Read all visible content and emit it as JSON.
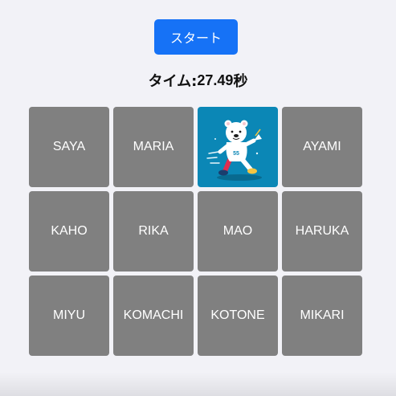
{
  "start_button": {
    "label": "スタート"
  },
  "timer": {
    "label": "タイム: ",
    "value": "27.49",
    "unit": "秒"
  },
  "cards": [
    {
      "label": "SAYA",
      "revealed": false
    },
    {
      "label": "MARIA",
      "revealed": false
    },
    {
      "label": "",
      "revealed": true,
      "image": "bear-mascot-icon"
    },
    {
      "label": "AYAMI",
      "revealed": false
    },
    {
      "label": "KAHO",
      "revealed": false
    },
    {
      "label": "RIKA",
      "revealed": false
    },
    {
      "label": "MAO",
      "revealed": false
    },
    {
      "label": "HARUKA",
      "revealed": false
    },
    {
      "label": "MIYU",
      "revealed": false
    },
    {
      "label": "KOMACHI",
      "revealed": false
    },
    {
      "label": "KOTONE",
      "revealed": false
    },
    {
      "label": "MIKARI",
      "revealed": false
    }
  ],
  "colors": {
    "background": "#f2f2f7",
    "button": "#1672f6",
    "card_hidden": "#808080",
    "card_revealed": "#0b87b6"
  }
}
